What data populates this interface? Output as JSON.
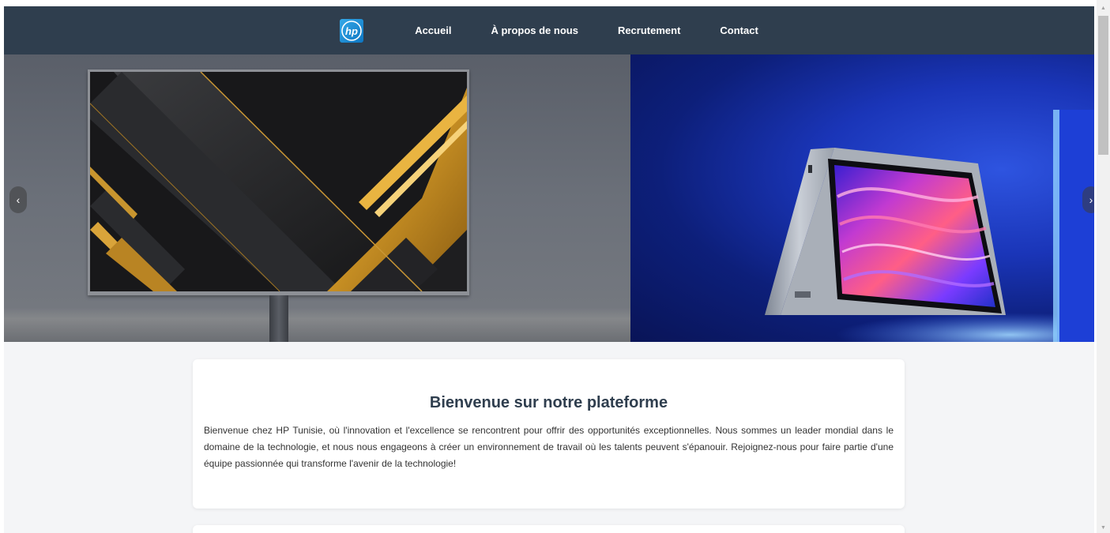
{
  "nav": {
    "logo_text": "hp",
    "links": [
      {
        "label": "Accueil"
      },
      {
        "label": "À propos de nous"
      },
      {
        "label": "Recrutement"
      },
      {
        "label": "Contact"
      }
    ]
  },
  "carousel": {
    "prev_glyph": "‹",
    "next_glyph": "›",
    "slide_count": 2
  },
  "welcome": {
    "title": "Bienvenue sur notre plateforme",
    "body": "Bienvenue chez HP Tunisie, où l'innovation et l'excellence se rencontrent pour offrir des opportunités exceptionnelles. Nous sommes un leader mondial dans le domaine de la technologie, et nous nous engageons à créer un environnement de travail où les talents peuvent s'épanouir. Rejoignez-nous pour faire partie d'une équipe passionnée qui transforme l'avenir de la technologie!"
  },
  "colors": {
    "navbar": "#2f3e4e",
    "logo_blue": "#0e76c2",
    "title": "#2f3e4e",
    "page_bg": "#f4f5f7"
  },
  "icons": {
    "prev": "chevron-left-icon",
    "next": "chevron-right-icon",
    "scroll_up": "caret-up-icon",
    "scroll_down": "caret-down-icon"
  },
  "scroll": {
    "up_glyph": "▲",
    "down_glyph": "▼"
  }
}
